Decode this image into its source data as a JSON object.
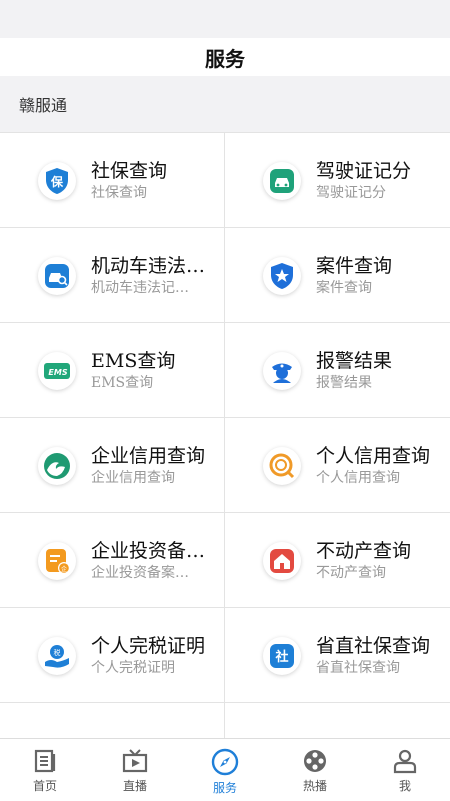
{
  "header": {
    "title": "服务"
  },
  "section": {
    "label": "赣服通"
  },
  "services": [
    {
      "title": "社保查询",
      "subtitle": "社保查询",
      "icon": "shield-bao-icon",
      "color": "#1e7fd6"
    },
    {
      "title": "驾驶证记分",
      "subtitle": "驾驶证记分",
      "icon": "car-icon",
      "color": "#1fa27a"
    },
    {
      "title": "机动车违法…",
      "subtitle": "机动车违法记…",
      "icon": "car-search-icon",
      "color": "#1e7fd6"
    },
    {
      "title": "案件查询",
      "subtitle": "案件查询",
      "icon": "police-star-icon",
      "color": "#1e6fd9"
    },
    {
      "title": "EMS查询",
      "subtitle": "EMS查询",
      "icon": "ems-icon",
      "color": "#21a77a"
    },
    {
      "title": "报警结果",
      "subtitle": "报警结果",
      "icon": "police-icon",
      "color": "#1e6fd9"
    },
    {
      "title": "企业信用查询",
      "subtitle": "企业信用查询",
      "icon": "wave-icon",
      "color": "#1f9a72"
    },
    {
      "title": "个人信用查询",
      "subtitle": "个人信用查询",
      "icon": "credit-icon",
      "color": "#f09a28"
    },
    {
      "title": "企业投资备…",
      "subtitle": "企业投资备案…",
      "icon": "enterprise-doc-icon",
      "color": "#f39a1f"
    },
    {
      "title": "不动产查询",
      "subtitle": "不动产查询",
      "icon": "house-icon",
      "color": "#e34a40"
    },
    {
      "title": "个人完税证明",
      "subtitle": "个人完税证明",
      "icon": "tax-hand-icon",
      "color": "#1e7fd6"
    },
    {
      "title": "省直社保查询",
      "subtitle": "省直社保查询",
      "icon": "she-icon",
      "color": "#1e7fd6"
    }
  ],
  "tabs": [
    {
      "label": "首页",
      "icon": "home-doc-icon",
      "active": false
    },
    {
      "label": "直播",
      "icon": "tv-play-icon",
      "active": false
    },
    {
      "label": "服务",
      "icon": "compass-icon",
      "active": true
    },
    {
      "label": "热播",
      "icon": "film-reel-icon",
      "active": false
    },
    {
      "label": "我",
      "icon": "person-icon",
      "active": false
    }
  ]
}
